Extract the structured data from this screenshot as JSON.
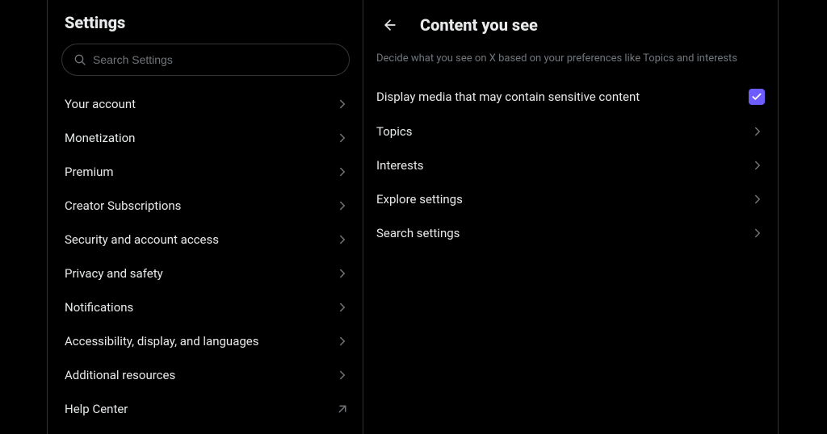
{
  "settings": {
    "title": "Settings",
    "search_placeholder": "Search Settings",
    "items": [
      {
        "label": "Your account",
        "icon": "chevron"
      },
      {
        "label": "Monetization",
        "icon": "chevron"
      },
      {
        "label": "Premium",
        "icon": "chevron"
      },
      {
        "label": "Creator Subscriptions",
        "icon": "chevron"
      },
      {
        "label": "Security and account access",
        "icon": "chevron"
      },
      {
        "label": "Privacy and safety",
        "icon": "chevron"
      },
      {
        "label": "Notifications",
        "icon": "chevron"
      },
      {
        "label": "Accessibility, display, and languages",
        "icon": "chevron"
      },
      {
        "label": "Additional resources",
        "icon": "chevron"
      },
      {
        "label": "Help Center",
        "icon": "external"
      }
    ]
  },
  "content": {
    "title": "Content you see",
    "description": "Decide what you see on X based on your preferences like Topics and interests",
    "sensitive_label": "Display media that may contain sensitive content",
    "sensitive_checked": true,
    "rows": [
      {
        "label": "Topics"
      },
      {
        "label": "Interests"
      },
      {
        "label": "Explore settings"
      },
      {
        "label": "Search settings"
      }
    ]
  }
}
